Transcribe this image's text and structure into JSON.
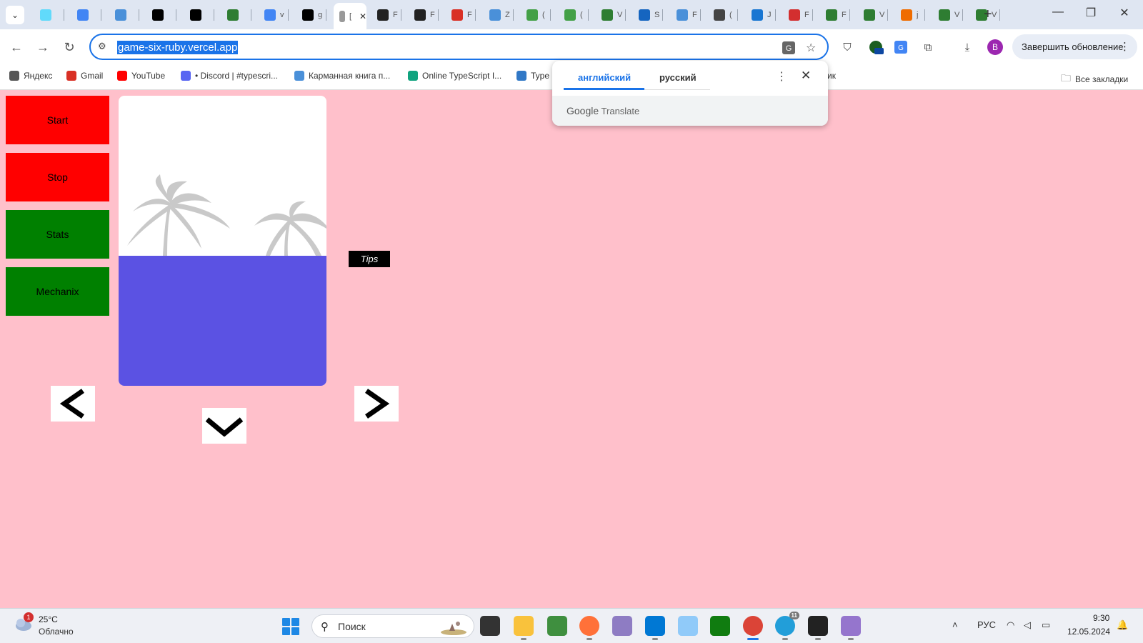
{
  "browser": {
    "tabs": [
      {
        "icon": "react-icon",
        "color": "#61dafb",
        "title": ""
      },
      {
        "icon": "translate-icon",
        "color": "#4285f4",
        "title": ""
      },
      {
        "icon": "extension-icon",
        "color": "#4a90d9",
        "title": ""
      },
      {
        "icon": "nextjs-icon",
        "color": "#000000",
        "title": ""
      },
      {
        "icon": "vercel-icon",
        "color": "#000000",
        "title": ""
      },
      {
        "icon": "pixso-icon",
        "color": "#2e7d32",
        "title": ""
      },
      {
        "icon": "google-icon",
        "color": "#4285f4",
        "title": "v"
      },
      {
        "icon": "vercel-icon",
        "color": "#000000",
        "title": "g"
      },
      {
        "icon": "page-icon",
        "color": "#999999",
        "title": "["
      },
      {
        "icon": "react-icon",
        "color": "#222222",
        "title": "F"
      },
      {
        "icon": "react-icon",
        "color": "#222222",
        "title": "F"
      },
      {
        "icon": "gmail-icon",
        "color": "#d93025",
        "title": "F"
      },
      {
        "icon": "extension-icon",
        "color": "#4a90d9",
        "title": "Z"
      },
      {
        "icon": "leaf-icon",
        "color": "#43a047",
        "title": "("
      },
      {
        "icon": "leaf-icon",
        "color": "#43a047",
        "title": "("
      },
      {
        "icon": "vue-icon",
        "color": "#2e7d32",
        "title": "V"
      },
      {
        "icon": "stackoverflow-icon",
        "color": "#1565c0",
        "title": "S"
      },
      {
        "icon": "extension-icon",
        "color": "#4a90d9",
        "title": "F"
      },
      {
        "icon": "openai-icon",
        "color": "#444444",
        "title": "("
      },
      {
        "icon": "cloud-icon",
        "color": "#1976d2",
        "title": "J"
      },
      {
        "icon": "hh-icon",
        "color": "#d32f2f",
        "title": "F"
      },
      {
        "icon": "pixso-icon",
        "color": "#2e7d32",
        "title": "F"
      },
      {
        "icon": "vue-icon",
        "color": "#2e7d32",
        "title": "V"
      },
      {
        "icon": "draw-icon",
        "color": "#ef6c00",
        "title": "j"
      },
      {
        "icon": "vue-icon",
        "color": "#2e7d32",
        "title": "V"
      },
      {
        "icon": "vue-icon",
        "color": "#2e7d32",
        "title": "V"
      }
    ],
    "active_tab_index": 8,
    "url": "game-six-ruby.vercel.app",
    "update_button": "Завершить обновление",
    "profile_letter": "B",
    "bookmarks": [
      {
        "label": "Яндекс",
        "icon": "yandex-icon",
        "color": "#555555"
      },
      {
        "label": "Gmail",
        "icon": "gmail-icon",
        "color": "#d93025"
      },
      {
        "label": "YouTube",
        "icon": "youtube-icon",
        "color": "#ff0000"
      },
      {
        "label": "• Discord | #typescri...",
        "icon": "discord-icon",
        "color": "#5865f2"
      },
      {
        "label": "Карманная книга п...",
        "icon": "extension-icon",
        "color": "#4a90d9"
      },
      {
        "label": "Online TypeScript I...",
        "icon": "openai-icon",
        "color": "#10a37f"
      },
      {
        "label": "Type",
        "icon": "typescript-icon",
        "color": "#3178c6"
      },
      {
        "label": "ик",
        "icon": "",
        "color": ""
      }
    ],
    "all_bookmarks": "Все закладки"
  },
  "translate_popup": {
    "lang_source": "английский",
    "lang_target": "русский",
    "brand_google": "Google",
    "brand_translate": "Translate"
  },
  "page": {
    "buttons": {
      "start": "Start",
      "stop": "Stop",
      "stats": "Stats",
      "mechanix": "Mechanix"
    },
    "tips": "Tips",
    "colors": {
      "background": "#ffc0cb",
      "red_button": "#ff0000",
      "green_button": "#008000",
      "water": "#5b52e3"
    }
  },
  "taskbar": {
    "weather_temp": "25°C",
    "weather_desc": "Облачно",
    "weather_badge": "1",
    "search_placeholder": "Поиск",
    "language": "РУС",
    "time": "9:30",
    "date": "12.05.2024",
    "telegram_badge": "11"
  }
}
